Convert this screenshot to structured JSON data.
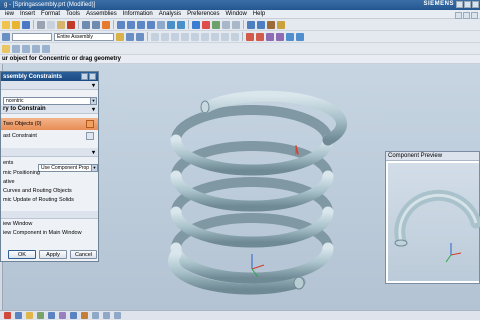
{
  "window": {
    "title": "g - [Springassembly.prt (Modified)]",
    "brand": "SIEMENS"
  },
  "menu": [
    "iew",
    "Insert",
    "Format",
    "Tools",
    "Assemblies",
    "Information",
    "Analysis",
    "Preferences",
    "Window",
    "Help"
  ],
  "toolbar": {
    "assembly_filter": "Entire Assembly"
  },
  "cue_line": "ur object for Concentric or drag geometry",
  "dialog": {
    "title": "ssembly Constraints",
    "type_value": "ncentric",
    "section_geometry": "ry to Constrain",
    "select_two_objects": "Two Objects (0)",
    "last_constraint": "ast Constraint",
    "settings_label": "ents",
    "settings_value": "Use Component Prop",
    "positioning": "mic Positioning",
    "associative": "ative",
    "routing_curves": "Curves and Routing Objects",
    "routing_update": "mic Update of Routing Solids",
    "preview_window": "iew Window",
    "preview_component": "iew Component in Main Window",
    "ok": "OK",
    "apply": "Apply",
    "cancel": "Cancel"
  },
  "preview": {
    "title": "Component Preview"
  },
  "colors": {
    "title_bar": "#245690",
    "spring": "#a9c2cb",
    "selected_row": "#e88d55",
    "viewport": "#bccbd9"
  },
  "icons": [
    "open-icon",
    "save-icon",
    "undo-icon",
    "redo-icon",
    "filter-icon",
    "snap-icon",
    "view-icon",
    "constraint-icon",
    "select-icon",
    "rotate-icon",
    "zoom-icon",
    "shade-icon"
  ]
}
